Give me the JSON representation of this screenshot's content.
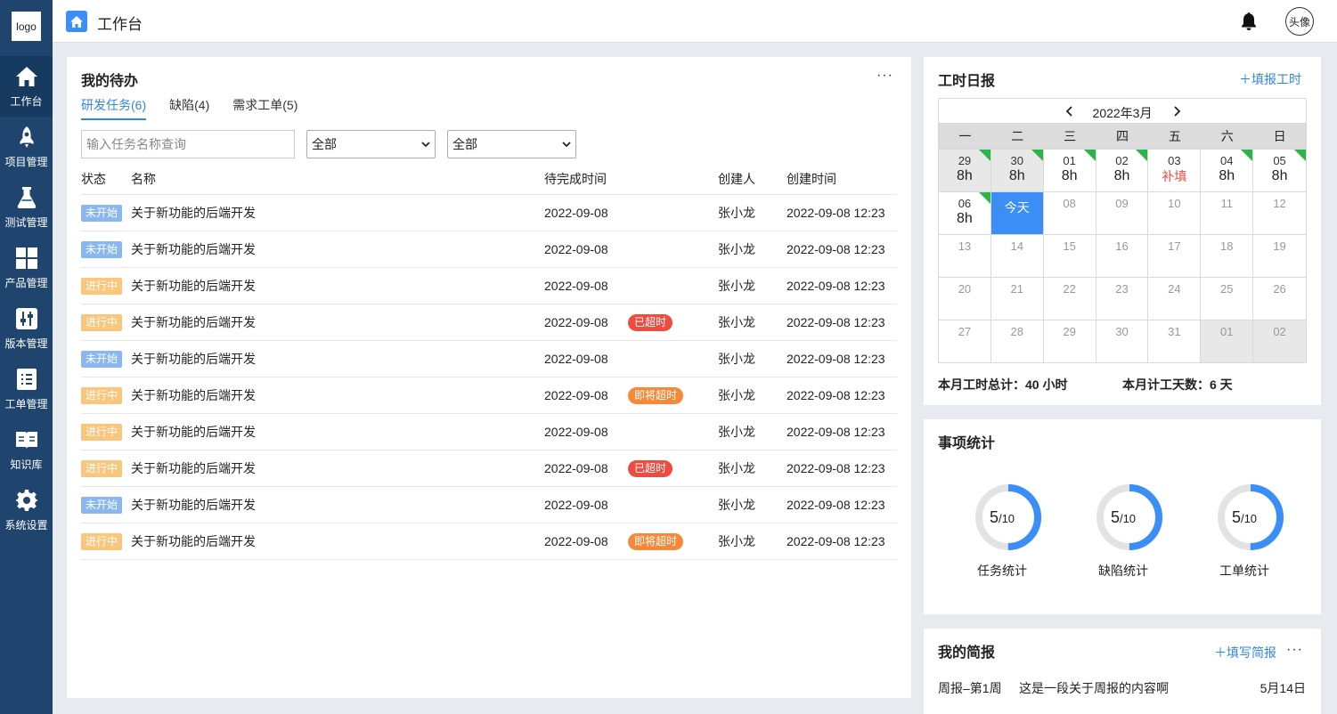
{
  "sidebar": {
    "logo": "logo",
    "items": [
      {
        "label": "工作台",
        "icon": "home-icon"
      },
      {
        "label": "项目管理",
        "icon": "rocket-icon"
      },
      {
        "label": "测试管理",
        "icon": "flask-icon"
      },
      {
        "label": "产品管理",
        "icon": "grid-icon"
      },
      {
        "label": "版本管理",
        "icon": "sliders-icon"
      },
      {
        "label": "工单管理",
        "icon": "list-icon"
      },
      {
        "label": "知识库",
        "icon": "book-icon"
      },
      {
        "label": "系统设置",
        "icon": "gear-icon"
      }
    ]
  },
  "header": {
    "title": "工作台",
    "avatar": "头像"
  },
  "todo": {
    "title": "我的待办",
    "more": "···",
    "tabs": [
      "研发任务(6)",
      "缺陷(4)",
      "需求工单(5)"
    ],
    "search_placeholder": "输入任务名称查询",
    "filter1": "全部",
    "filter2": "全部",
    "columns": [
      "状态",
      "名称",
      "待完成时间",
      "创建人",
      "创建时间"
    ],
    "rows": [
      {
        "status": "未开始",
        "type": "todo",
        "name": "关于新功能的后端开发",
        "due": "2022-09-08",
        "tag": "",
        "tagType": "",
        "creator": "张小龙",
        "created": "2022-09-08 12:23"
      },
      {
        "status": "未开始",
        "type": "todo",
        "name": "关于新功能的后端开发",
        "due": "2022-09-08",
        "tag": "",
        "tagType": "",
        "creator": "张小龙",
        "created": "2022-09-08 12:23"
      },
      {
        "status": "进行中",
        "type": "doing",
        "name": "关于新功能的后端开发",
        "due": "2022-09-08",
        "tag": "",
        "tagType": "",
        "creator": "张小龙",
        "created": "2022-09-08 12:23"
      },
      {
        "status": "进行中",
        "type": "doing",
        "name": "关于新功能的后端开发",
        "due": "2022-09-08",
        "tag": "已超时",
        "tagType": "overdue",
        "creator": "张小龙",
        "created": "2022-09-08 12:23"
      },
      {
        "status": "未开始",
        "type": "todo",
        "name": "关于新功能的后端开发",
        "due": "2022-09-08",
        "tag": "",
        "tagType": "",
        "creator": "张小龙",
        "created": "2022-09-08 12:23"
      },
      {
        "status": "进行中",
        "type": "doing",
        "name": "关于新功能的后端开发",
        "due": "2022-09-08",
        "tag": "即将超时",
        "tagType": "soon",
        "creator": "张小龙",
        "created": "2022-09-08 12:23"
      },
      {
        "status": "进行中",
        "type": "doing",
        "name": "关于新功能的后端开发",
        "due": "2022-09-08",
        "tag": "",
        "tagType": "",
        "creator": "张小龙",
        "created": "2022-09-08 12:23"
      },
      {
        "status": "进行中",
        "type": "doing",
        "name": "关于新功能的后端开发",
        "due": "2022-09-08",
        "tag": "已超时",
        "tagType": "overdue",
        "creator": "张小龙",
        "created": "2022-09-08 12:23"
      },
      {
        "status": "未开始",
        "type": "todo",
        "name": "关于新功能的后端开发",
        "due": "2022-09-08",
        "tag": "",
        "tagType": "",
        "creator": "张小龙",
        "created": "2022-09-08 12:23"
      },
      {
        "status": "进行中",
        "type": "doing",
        "name": "关于新功能的后端开发",
        "due": "2022-09-08",
        "tag": "即将超时",
        "tagType": "soon",
        "creator": "张小龙",
        "created": "2022-09-08 12:23"
      }
    ],
    "colors": {
      "overdue": "#ee4c3f",
      "soon": "#f5893a",
      "todo": "#8ab7ef",
      "doing": "#f9c67b"
    }
  },
  "timesheet": {
    "title": "工时日报",
    "add_label": "填报工时",
    "month": "2022年3月",
    "weekdays": [
      "一",
      "二",
      "三",
      "四",
      "五",
      "六",
      "日"
    ],
    "days": [
      {
        "d": "29",
        "h": "8h",
        "other": true,
        "done": true
      },
      {
        "d": "30",
        "h": "8h",
        "other": true,
        "done": true
      },
      {
        "d": "01",
        "h": "8h",
        "done": true
      },
      {
        "d": "02",
        "h": "8h",
        "done": true
      },
      {
        "d": "03",
        "fill": "补填"
      },
      {
        "d": "04",
        "h": "8h",
        "done": true
      },
      {
        "d": "05",
        "h": "8h",
        "done": true
      },
      {
        "d": "06",
        "h": "8h",
        "done": true
      },
      {
        "d": "今天",
        "today": true
      },
      {
        "d": "08"
      },
      {
        "d": "09"
      },
      {
        "d": "10"
      },
      {
        "d": "11"
      },
      {
        "d": "12"
      },
      {
        "d": "13"
      },
      {
        "d": "14"
      },
      {
        "d": "15"
      },
      {
        "d": "16"
      },
      {
        "d": "17"
      },
      {
        "d": "18"
      },
      {
        "d": "19"
      },
      {
        "d": "20"
      },
      {
        "d": "21"
      },
      {
        "d": "22"
      },
      {
        "d": "23"
      },
      {
        "d": "24"
      },
      {
        "d": "25"
      },
      {
        "d": "26"
      },
      {
        "d": "27"
      },
      {
        "d": "28"
      },
      {
        "d": "29"
      },
      {
        "d": "30"
      },
      {
        "d": "31"
      },
      {
        "d": "01",
        "other": true
      },
      {
        "d": "02",
        "other": true
      }
    ],
    "total_hours": "本月工时总计：40 小时",
    "total_days": "本月计工天数：6 天"
  },
  "stats": {
    "title": "事项统计",
    "items": [
      {
        "label": "任务统计",
        "value": 5,
        "total": 10
      },
      {
        "label": "缺陷统计",
        "value": 5,
        "total": 10
      },
      {
        "label": "工单统计",
        "value": 5,
        "total": 10
      }
    ],
    "colors": {
      "ring": "#3a8ef6",
      "track": "#e3e3e3"
    }
  },
  "brief": {
    "title": "我的简报",
    "add_label": "填写简报",
    "more": "···",
    "item": {
      "name": "周报–第1周",
      "content": "这是一段关于周报的内容啊",
      "date": "5月14日"
    }
  }
}
